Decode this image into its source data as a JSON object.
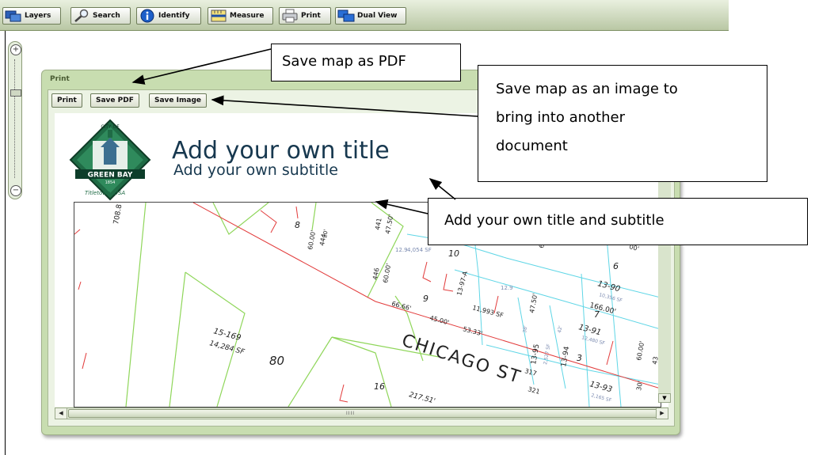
{
  "toolbar": {
    "buttons": [
      {
        "label": "Layers",
        "icon": "layers-icon"
      },
      {
        "label": "Search",
        "icon": "search-icon"
      },
      {
        "label": "Identify",
        "icon": "info-icon"
      },
      {
        "label": "Measure",
        "icon": "ruler-icon"
      },
      {
        "label": "Print",
        "icon": "printer-icon"
      },
      {
        "label": "Dual View",
        "icon": "dual-view-icon"
      }
    ]
  },
  "zoom": {
    "in_symbol": "+",
    "out_symbol": "−"
  },
  "print_panel": {
    "title": "Print",
    "buttons": {
      "print": "Print",
      "save_pdf": "Save PDF",
      "save_image": "Save Image"
    },
    "page": {
      "title": "Add your own title",
      "subtitle": "Add your own subtitle",
      "logo": {
        "top_text": "CITY OF",
        "band_text": "GREEN BAY",
        "year": "1854",
        "bottom_text": "Titletown, USA"
      }
    },
    "scroll_grip": "IIII"
  },
  "map": {
    "labels": {
      "l708": "708.8",
      "lot8": "8",
      "dim6000a": "60.00'",
      "n444": "444",
      "n441": "441",
      "dim4750a": "47.50'",
      "lot10": "10",
      "sf4054": "4,054 SF",
      "n12": "12.9",
      "n446": "446",
      "dim6000b": "60.00'",
      "dim6666": "66.66'",
      "lot9": "9",
      "parcel1397a": "13-97-A",
      "sf11993": "11,993 SF",
      "n129": "12.9",
      "dim4750b": "47.50'",
      "dim4500": "45.00'",
      "dim5333": "53.33'",
      "lot6": "6",
      "parcel1390": "13-90",
      "sf10356": "10,356 SF",
      "dim16600": "166.00'",
      "lot7": "7",
      "parcel1391": "13-91",
      "sf12480": "12,480 SF",
      "parcel15169": "15-169",
      "sf14284": "14,284 SF",
      "lot80": "80",
      "street": "CHICAGO ST",
      "n317": "317",
      "n321": "321",
      "lot16": "16",
      "dim21751": "217.51'",
      "parcel1395": "13-95",
      "sf2527": "2,527 SF",
      "parcel1394": "13-94",
      "lot3": "3",
      "parcel1393": "13-93",
      "sf2165": "2,165 SF",
      "dim6000c": "60.00'",
      "n30": "30'",
      "n20": "20'",
      "n38": "38'",
      "n42": "42'",
      "n60": "60'",
      "dim000": "00'",
      "n43": "43"
    }
  },
  "callouts": {
    "pdf": "Save map as PDF",
    "image_lines": [
      "Save map as an image to",
      "bring into another",
      "document"
    ],
    "title": "Add your own title and subtitle"
  },
  "colors": {
    "toolbar": "#b9c7a4",
    "panel": "#c8ddb0",
    "title_text": "#17384f",
    "map_green": "#8fd65a",
    "map_cyan": "#5fd6e6",
    "map_red": "#e23b3b",
    "logo_green": "#1f6b45"
  }
}
